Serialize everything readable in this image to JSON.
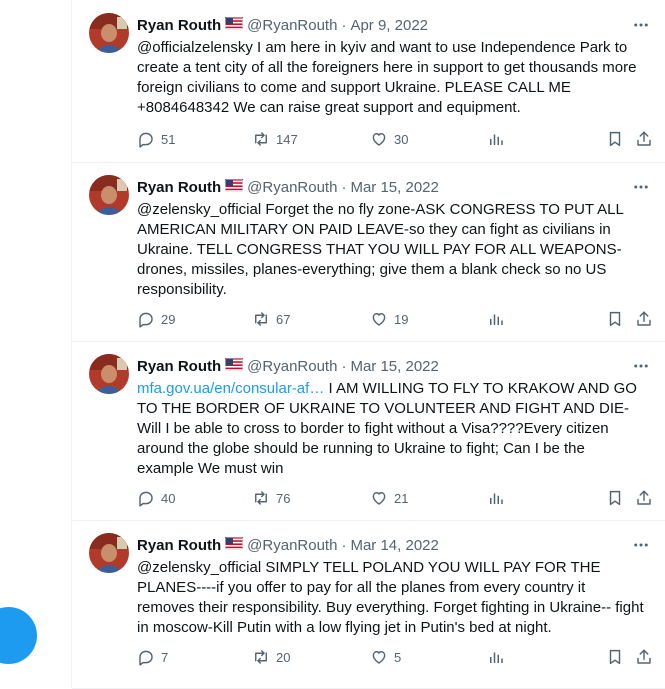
{
  "author": {
    "name": "Ryan Routh",
    "handle": "@RyanRouth",
    "dot": "·"
  },
  "colors": {
    "accent": "#1d9bf0",
    "text": "#0f1419",
    "muted": "#536471",
    "divider": "#eff3f4"
  },
  "tweets": [
    {
      "date": "Apr 9, 2022",
      "link": "",
      "text": "@officialzelensky I am here in kyiv and want to use Independence Park to create a tent city of all the foreigners here in support to get thousands more foreign civilians to come and support Ukraine. PLEASE CALL ME +8084648342 We can raise great support and equipment.",
      "replies": "51",
      "retweets": "147",
      "likes": "30"
    },
    {
      "date": "Mar 15, 2022",
      "link": "",
      "text": "@zelensky_official Forget the no fly zone-ASK CONGRESS TO PUT ALL AMERICAN MILITARY ON PAID LEAVE-so they can fight as civilians in Ukraine.  TELL CONGRESS THAT YOU WILL PAY FOR ALL WEAPONS-drones, missiles, planes-everything; give them a blank check so no US responsibility.",
      "replies": "29",
      "retweets": "67",
      "likes": "19"
    },
    {
      "date": "Mar 15, 2022",
      "link": "mfa.gov.ua/en/consular-af…",
      "text": " I AM WILLING TO FLY TO KRAKOW AND GO TO THE BORDER OF UKRAINE TO VOLUNTEER AND FIGHT AND DIE-Will I be able to cross to border to fight without a Visa????Every citizen around the globe should be running to Ukraine to fight; Can I be the example We must win",
      "replies": "40",
      "retweets": "76",
      "likes": "21"
    },
    {
      "date": "Mar 14, 2022",
      "link": "",
      "text": "@zelensky_official SIMPLY TELL POLAND YOU WILL PAY FOR THE PLANES----if you offer to pay for all the planes from every country it removes their responsibility.  Buy everything.  Forget fighting in Ukraine-- fight in moscow-Kill Putin with a low flying jet in Putin's bed at night.",
      "replies": "7",
      "retweets": "20",
      "likes": "5"
    }
  ],
  "icons": {
    "more": "more-icon",
    "reply": "reply-icon",
    "retweet": "retweet-icon",
    "like": "heart-icon",
    "views": "views-icon",
    "bookmark": "bookmark-icon",
    "share": "share-icon",
    "flag": "us-flag-icon"
  }
}
